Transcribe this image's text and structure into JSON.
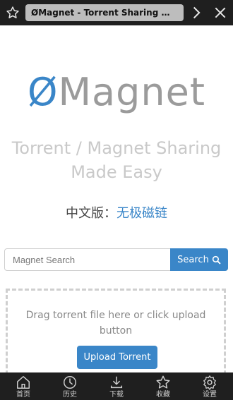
{
  "browser": {
    "tab_title": "ØMagnet - Torrent Sharing Made Easy",
    "icons": {
      "bookmark": "star-icon",
      "forward": "chevron-right-icon",
      "close": "close-icon"
    }
  },
  "page": {
    "logo_o": "Ø",
    "logo_rest": "Magnet",
    "tagline": "Torrent / Magnet Sharing Made Easy",
    "chinese_label": "中文版：",
    "chinese_link": "无极磁链",
    "search": {
      "placeholder": "Magnet Search",
      "button": "Search"
    },
    "dropzone": {
      "message": "Drag torrent file here or click upload button",
      "upload_button": "Upload Torrent"
    }
  },
  "bottom_nav": [
    {
      "label": "首页",
      "icon": "home-icon"
    },
    {
      "label": "历史",
      "icon": "clock-icon"
    },
    {
      "label": "下载",
      "icon": "download-icon"
    },
    {
      "label": "收藏",
      "icon": "star-icon"
    },
    {
      "label": "设置",
      "icon": "gear-icon"
    }
  ],
  "colors": {
    "accent": "#3a86c8",
    "bar": "#1f1f1f"
  }
}
